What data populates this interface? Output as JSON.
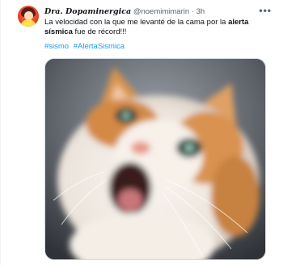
{
  "author": {
    "display_name": "Dra. Dopaminergica",
    "handle": "@noemimimarin",
    "separator": "·",
    "time": "3h"
  },
  "menu": {
    "more_glyph": "•••"
  },
  "body": {
    "part1": "La velocidad con la que me levanté de la cama por la ",
    "bold": "alerta sísmica",
    "part2": " fue de récord!!!"
  },
  "hashtags": [
    "#sismo",
    "#AlertaSismica"
  ],
  "media": {
    "subject": "cat-photo"
  }
}
